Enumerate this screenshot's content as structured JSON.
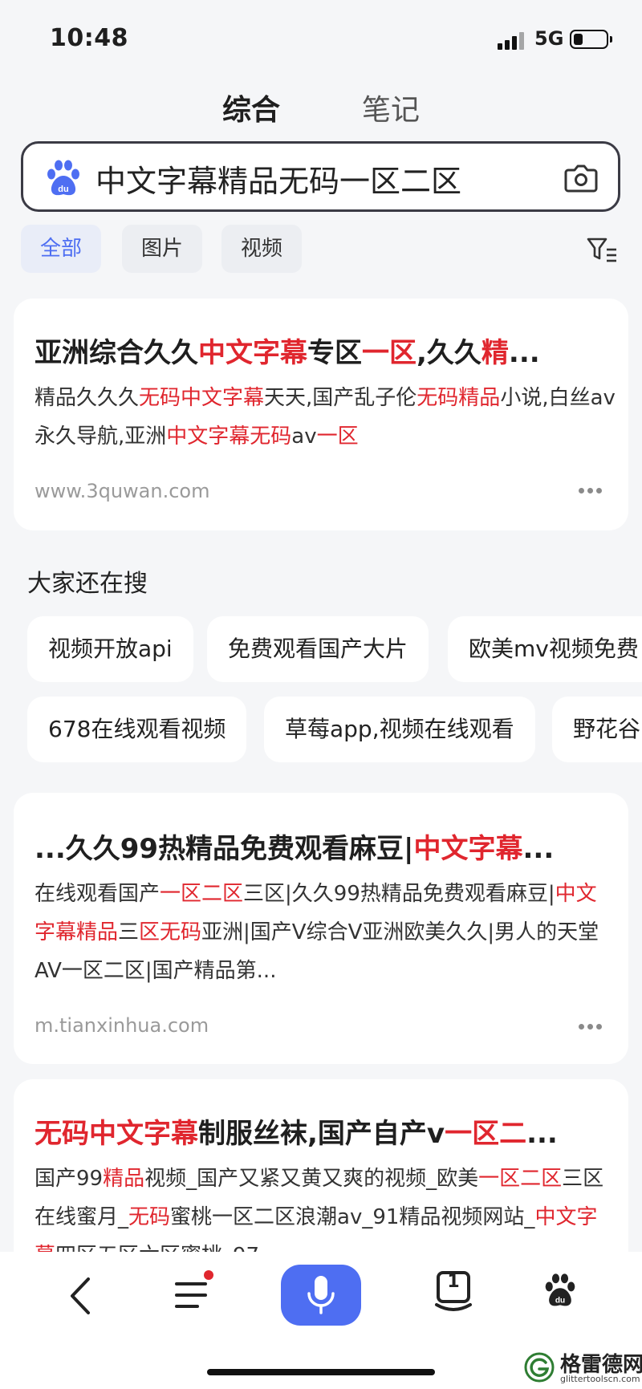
{
  "status": {
    "time": "10:48",
    "network": "5G",
    "battery_level": 0.3
  },
  "top_tabs": [
    {
      "label": "综合",
      "active": true
    },
    {
      "label": "笔记",
      "active": false
    }
  ],
  "search": {
    "query": "中文字幕精品无码一区二区"
  },
  "filters": [
    {
      "label": "全部",
      "active": true
    },
    {
      "label": "图片",
      "active": false
    },
    {
      "label": "视频",
      "active": false
    }
  ],
  "results": [
    {
      "title": [
        {
          "t": "亚洲综合久久",
          "h": false
        },
        {
          "t": "中文字幕",
          "h": true
        },
        {
          "t": "专区",
          "h": false
        },
        {
          "t": "一区",
          "h": true
        },
        {
          "t": ",久久",
          "h": false
        },
        {
          "t": "精",
          "h": true
        },
        {
          "t": "...",
          "h": false
        }
      ],
      "desc": [
        {
          "t": "精品久久久",
          "h": false
        },
        {
          "t": "无码中文字幕",
          "h": true
        },
        {
          "t": "天天,国产乱子伦",
          "h": false
        },
        {
          "t": "无码精品",
          "h": true
        },
        {
          "t": "小说,白丝av永久导航,亚洲",
          "h": false
        },
        {
          "t": "中文字幕无码",
          "h": true
        },
        {
          "t": "av",
          "h": false
        },
        {
          "t": "一区",
          "h": true
        }
      ],
      "url": "www.3quwan.com"
    },
    {
      "title": [
        {
          "t": "...久久99热精品免费观看麻豆|",
          "h": false
        },
        {
          "t": "中文字幕",
          "h": true
        },
        {
          "t": "...",
          "h": false
        }
      ],
      "desc": [
        {
          "t": "在线观看国产",
          "h": false
        },
        {
          "t": "一区二区",
          "h": true
        },
        {
          "t": "三区|久久99热精品免费观看麻豆|",
          "h": false
        },
        {
          "t": "中文字幕精品",
          "h": true
        },
        {
          "t": "三",
          "h": false
        },
        {
          "t": "区无码",
          "h": true
        },
        {
          "t": "亚洲|国产V综合V亚洲欧美久久|男人的天堂AV一区二区|国产精品第...",
          "h": false
        }
      ],
      "url": "m.tianxinhua.com"
    },
    {
      "title": [
        {
          "t": "无码中文字幕",
          "h": true
        },
        {
          "t": "制服丝袜,国产自产v",
          "h": false
        },
        {
          "t": "一区二",
          "h": true
        },
        {
          "t": "...",
          "h": false
        }
      ],
      "desc": [
        {
          "t": "国产99",
          "h": false
        },
        {
          "t": "精品",
          "h": true
        },
        {
          "t": "视频_国产又紧又黄又爽的视频_欧美",
          "h": false
        },
        {
          "t": "一区二区",
          "h": true
        },
        {
          "t": "三区在线蜜月_",
          "h": false
        },
        {
          "t": "无码",
          "h": true
        },
        {
          "t": "蜜桃一区二区浪潮av_91精品视频网站_",
          "h": false
        },
        {
          "t": "中文字幕",
          "h": true
        },
        {
          "t": "四区五区六区蜜桃_97",
          "h": false
        }
      ],
      "url": ""
    }
  ],
  "related": {
    "title": "大家还在搜",
    "row1": [
      "视频开放api",
      "免费观看国产大片",
      "欧美mv视频免费"
    ],
    "row2": [
      "678在线观看视频",
      "草莓app,视频在线观看",
      "野花谷"
    ]
  },
  "bottom_nav": {
    "tab_count": "1",
    "menu_has_dot": true
  },
  "watermark": {
    "title": "格雷德网",
    "domain": "glittertoolscn.com"
  },
  "colors": {
    "accent": "#4e6ef2",
    "highlight": "#e0262e",
    "background": "#f5f6f8"
  }
}
